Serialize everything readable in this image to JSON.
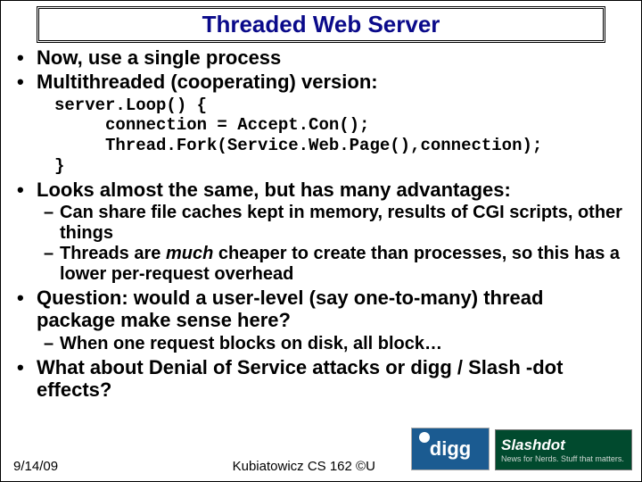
{
  "title": "Threaded Web Server",
  "bullets": {
    "b1": "Now, use a single process",
    "b2": "Multithreaded (cooperating) version:",
    "code": "server.Loop() {\n     connection = Accept.Con();\n     Thread.Fork(Service.Web.Page(),connection);\n}",
    "b3": "Looks almost the same, but has many advantages:",
    "b3s1": "Can share file caches kept in memory, results of CGI scripts, other things",
    "b3s2a": "Threads are ",
    "b3s2b": "much",
    "b3s2c": " cheaper to create than processes, so this has a lower per-request overhead",
    "b4": "Question: would a user-level (say one-to-many) thread package make sense here?",
    "b4s1": "When one request blocks on disk, all block…",
    "b5": "What about Denial of Service attacks or digg / Slash -dot effects?"
  },
  "footer": {
    "date": "9/14/09",
    "credit": "Kubiatowicz CS 162 ©U"
  },
  "logos": {
    "digg": "digg",
    "slashdot_top": "Slashdot",
    "slashdot_bot": "News for Nerds.  Stuff that matters."
  }
}
